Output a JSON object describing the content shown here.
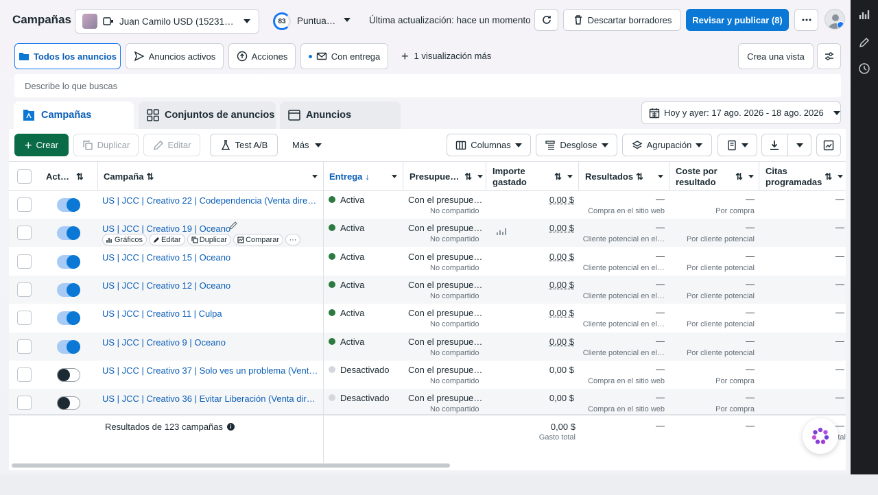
{
  "header": {
    "title": "Campañas",
    "account_name": "Juan Camilo USD (15231…",
    "score_value": "83",
    "score_label": "Puntua…",
    "last_update": "Última actualización: hace un momento",
    "discard_label": "Descartar borradores",
    "publish_label": "Revisar y publicar (8)"
  },
  "views": {
    "all_ads": "Todos los anuncios",
    "active_ads": "Anuncios activos",
    "actions": "Acciones",
    "with_delivery": "Con entrega",
    "more_views": "1 visualización más",
    "create_view": "Crea una vista"
  },
  "search": {
    "placeholder": "Describe lo que buscas"
  },
  "tabs": {
    "campaigns": "Campañas",
    "adsets": "Conjuntos de anuncios",
    "ads": "Anuncios"
  },
  "date_range": "Hoy y ayer: 17 ago. 2026 - 18 ago. 2026",
  "toolbar": {
    "create": "Crear",
    "duplicate": "Duplicar",
    "edit": "Editar",
    "ab_test": "Test A/B",
    "more": "Más",
    "columns": "Columnas",
    "breakdown": "Desglose",
    "grouping": "Agrupación"
  },
  "table": {
    "headers": {
      "active": "Act…",
      "campaign": "Campaña",
      "delivery": "Entrega",
      "budget": "Presupue…",
      "spent_1": "Importe",
      "spent_2": "gastado",
      "results": "Resultados",
      "cost_1": "Coste por",
      "cost_2": "resultado",
      "appts_1": "Citas",
      "appts_2": "programadas"
    },
    "rows": [
      {
        "on": true,
        "name": "US | JCC | Creativo 22 | Codependencia (Venta direc…",
        "delivery": "Activa",
        "budget": "Con el presupue…",
        "budget_sub": "No compartido",
        "spent": "0,00 $",
        "results": "—",
        "results_sub": "Compra en el sitio web",
        "cost": "—",
        "cost_sub": "Por compra",
        "appts": "—"
      },
      {
        "on": true,
        "name": "US | JCC | Creativo 19 | Oceano",
        "delivery": "Activa",
        "budget": "Con el presupue…",
        "budget_sub": "No compartido",
        "spent": "0,00 $",
        "results": "—",
        "results_sub": "Cliente potencial en el…",
        "cost": "—",
        "cost_sub": "Por cliente potencial",
        "appts": "—"
      },
      {
        "on": true,
        "name": "US | JCC | Creativo 15 | Oceano",
        "delivery": "Activa",
        "budget": "Con el presupue…",
        "budget_sub": "No compartido",
        "spent": "0,00 $",
        "results": "—",
        "results_sub": "Cliente potencial en el…",
        "cost": "—",
        "cost_sub": "Por cliente potencial",
        "appts": "—"
      },
      {
        "on": true,
        "name": "US | JCC | Creativo 12 | Oceano",
        "delivery": "Activa",
        "budget": "Con el presupue…",
        "budget_sub": "No compartido",
        "spent": "0,00 $",
        "results": "—",
        "results_sub": "Cliente potencial en el…",
        "cost": "—",
        "cost_sub": "Por cliente potencial",
        "appts": "—"
      },
      {
        "on": true,
        "name": "US | JCC | Creativo 11 | Culpa",
        "delivery": "Activa",
        "budget": "Con el presupue…",
        "budget_sub": "No compartido",
        "spent": "0,00 $",
        "results": "—",
        "results_sub": "Cliente potencial en el…",
        "cost": "—",
        "cost_sub": "Por cliente potencial",
        "appts": "—"
      },
      {
        "on": true,
        "name": "US | JCC | Creativo 9 | Oceano",
        "delivery": "Activa",
        "budget": "Con el presupue…",
        "budget_sub": "No compartido",
        "spent": "0,00 $",
        "results": "—",
        "results_sub": "Cliente potencial en el…",
        "cost": "—",
        "cost_sub": "Por cliente potencial",
        "appts": "—"
      },
      {
        "on": false,
        "name": "US | JCC | Creativo 37 | Solo ves un problema (Venta …",
        "delivery": "Desactivado",
        "budget": "Con el presupue…",
        "budget_sub": "No compartido",
        "spent": "0,00 $",
        "results": "—",
        "results_sub": "Compra en el sitio web",
        "cost": "—",
        "cost_sub": "Por compra",
        "appts": "—"
      },
      {
        "on": false,
        "name": "US | JCC | Creativo 36 | Evitar Liberación (Venta dire…",
        "delivery": "Desactivado",
        "budget": "Con el presupue…",
        "budget_sub": "No compartido",
        "spent": "0,00 $",
        "results": "—",
        "results_sub": "Compra en el sitio web",
        "cost": "—",
        "cost_sub": "Por compra",
        "appts": "—"
      }
    ],
    "row_actions": {
      "charts": "Gráficos",
      "edit": "Editar",
      "duplicate": "Duplicar",
      "compare": "Comparar"
    },
    "footer": {
      "summary": "Resultados de 123 campañas",
      "total_spent": "0,00 $",
      "total_spent_label": "Gasto total",
      "results": "—",
      "cost": "—",
      "appts": "—",
      "appts_cut": "tal"
    }
  },
  "colors": {
    "accent": "#0a78d4",
    "create_green": "#0a6b47",
    "active_dot": "#2b7a3f"
  }
}
